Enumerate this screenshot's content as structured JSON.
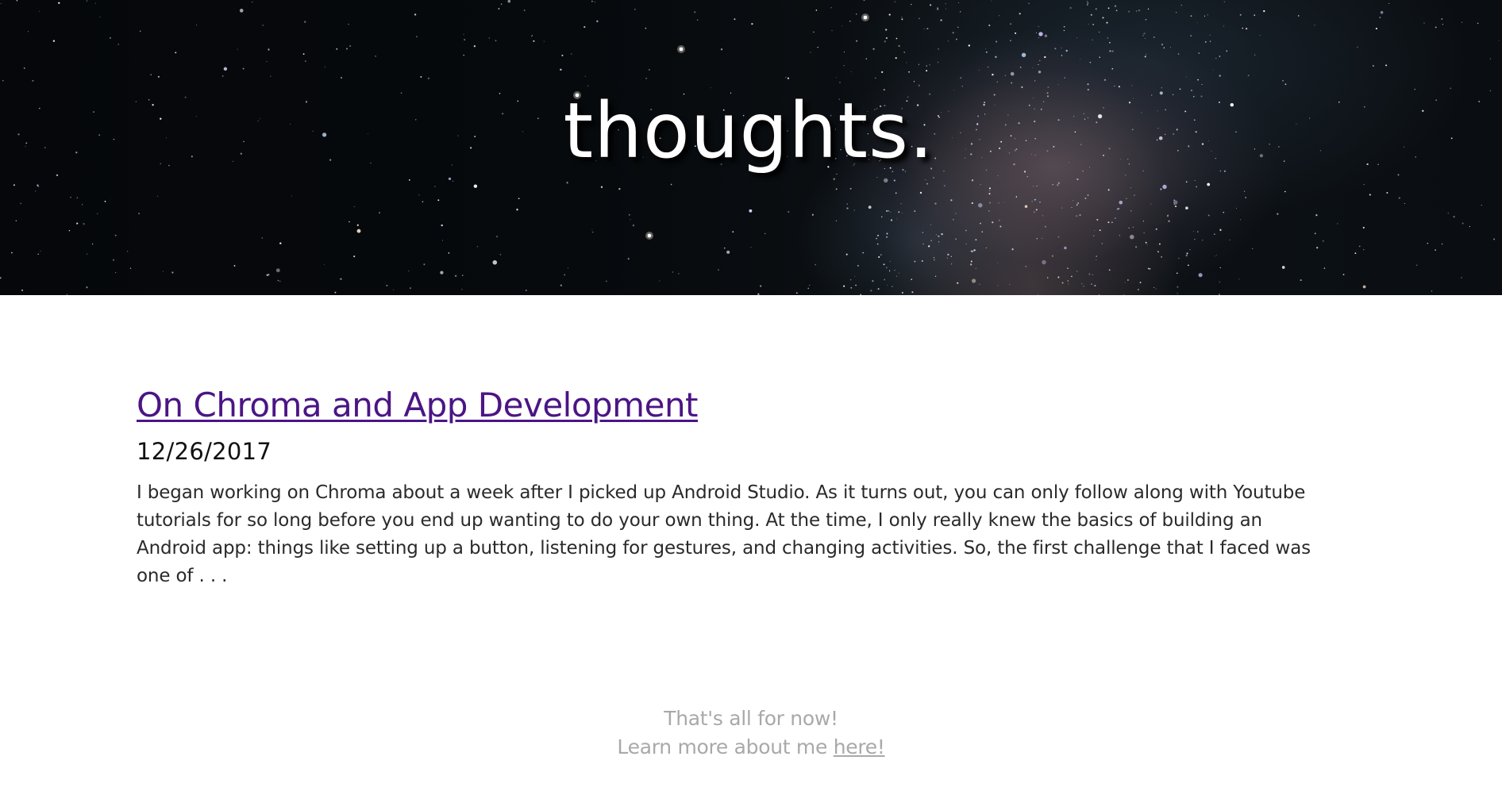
{
  "hero": {
    "title": "thoughts."
  },
  "posts": [
    {
      "title": "On Chroma and App Development",
      "date": "12/26/2017",
      "excerpt": "I began working on Chroma about a week after I picked up Android Studio. As it turns out, you can only follow along with Youtube tutorials for so long before you end up wanting to do your own thing. At the time, I only really knew the basics of building an Android app: things like setting up a button, listening for gestures, and changing activities. So, the first challenge that I faced was one of . . ."
    }
  ],
  "footer": {
    "line1": "That's all for now!",
    "line2_prefix": "Learn more about me ",
    "line2_link": "here!"
  },
  "colors": {
    "post_link": "#4b1585",
    "footer_text": "#a9a9a9",
    "hero_background": "#05070a"
  }
}
